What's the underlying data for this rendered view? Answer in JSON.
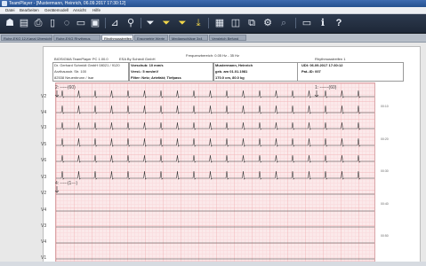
{
  "window": {
    "title": "TeamPlayer - [Mustermann, Heinrich, 06.09.2017 17:30:12]"
  },
  "menu": [
    "Datei",
    "Bearbeiten",
    "Gerätemodell",
    "Ansicht",
    "Hilfe"
  ],
  "toolbar": {
    "buttons": [
      {
        "name": "patient-icon",
        "glyph": "☗"
      },
      {
        "name": "open-icon",
        "glyph": "▤"
      },
      {
        "name": "print-icon",
        "glyph": "⎙"
      },
      {
        "name": "page-icon",
        "glyph": "▯"
      },
      {
        "name": "comment-icon",
        "glyph": "◌"
      },
      {
        "name": "card-icon",
        "glyph": "▭"
      },
      {
        "name": "save-icon",
        "glyph": "▣"
      },
      {
        "name": "measure-icon",
        "glyph": "⊿"
      },
      {
        "name": "zoom-icon",
        "glyph": "⚲"
      },
      {
        "name": "filter-icon",
        "glyph": "⏷"
      },
      {
        "name": "filter-yellow-icon",
        "glyph": "⏷"
      },
      {
        "name": "filter-yellow-2-icon",
        "glyph": "⏷"
      },
      {
        "name": "filter-down-icon",
        "glyph": "⤓"
      },
      {
        "name": "grid-icon",
        "glyph": "▦"
      },
      {
        "name": "layout-icon",
        "glyph": "◫"
      },
      {
        "name": "copy-icon",
        "glyph": "⧉"
      },
      {
        "name": "settings-icon",
        "glyph": "⚙"
      },
      {
        "name": "search-icon",
        "glyph": "⌕"
      },
      {
        "name": "monitor-icon",
        "glyph": "▭"
      },
      {
        "name": "info-icon",
        "glyph": "ℹ"
      },
      {
        "name": "help-icon",
        "glyph": "?"
      }
    ]
  },
  "tabs": [
    {
      "label": "Ruhe-EKG 12-Kanal Übersicht",
      "active": false
    },
    {
      "label": "Ruhe-EKG Rhythmus",
      "active": false
    },
    {
      "label": "Rhythmusstreifen",
      "active": true
    },
    {
      "label": "Ergometrie Werte",
      "active": false
    },
    {
      "label": "Medianschläge 3x4",
      "active": false
    },
    {
      "label": "Vergleich Befund",
      "active": false
    }
  ],
  "report": {
    "device": "BIOSIGMA  TeamPlayer PC 1.00.0",
    "company": "ESA By Schiedl GmbH",
    "range": "Frequenzbereich: 0.05 Hz - 35 Hz",
    "page": "Rhythmusstreifen 1",
    "doctor": "Dr. Gerhard Schmidt GmbH 08021 / 9120",
    "address1": "Arzthausstr. Str. 100",
    "address2": "82538 Neuenbrunn / Isar",
    "paper_speed": "Vorschub: 10 mm/s",
    "voltage": "Verst.: 5 mm/mV",
    "filter": "Filter: Netz; Artefakt; Tiefpass",
    "patient_name": "Mustermann, Heinrich",
    "birth": "geb. am 01.01.1981",
    "body": "170.0 cm, 80.0 kg",
    "record_date": "UDI: 06.09.2017 17:30:12",
    "pat_id": "Pat.-ID: 007",
    "marker1": "2: -----(60)",
    "marker2": "1: ------(60)",
    "marker3": "4: -----(1---)"
  },
  "leads": [
    "V2",
    "V4",
    "V3",
    "V5",
    "V6",
    "V3",
    "V2",
    "V4",
    "V3",
    "V4",
    "V1"
  ],
  "right_marks": [
    "00:10",
    "00:20",
    "00:30",
    "00:40",
    "00:50"
  ],
  "colors": {
    "toolbar": "#1d2737",
    "grid_bg": "#fbe9ea",
    "grid_major": "#f3b8bb",
    "ecg": "#3a3a3a"
  }
}
